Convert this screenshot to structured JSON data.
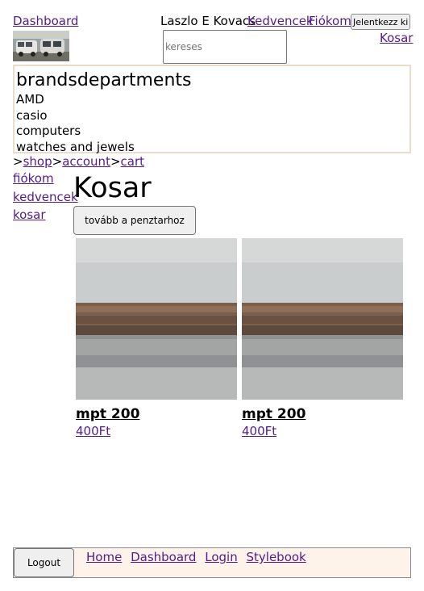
{
  "header": {
    "dashboard_link": "Dashboard",
    "user_name": "Laszlo E Kovacs",
    "favorites_link": "Kedvencek",
    "account_link": "Fiókom",
    "logout_label": "Jelentkezz ki",
    "cart_link": "Kosar",
    "search_placeholder": "kereses",
    "search_value": ""
  },
  "categories": {
    "title": "brandsdepartments",
    "items": [
      "AMD",
      "casio",
      "computers",
      "watches and jewels"
    ]
  },
  "breadcrumb": {
    "separator": ">",
    "items": [
      "shop",
      "account",
      "cart"
    ]
  },
  "sidebar": {
    "items": [
      "fiókom",
      "kedvencek",
      "kosar"
    ]
  },
  "main": {
    "title": "Kosar",
    "checkout_label": "tovább a penztarhoz",
    "products": [
      {
        "name": "mpt 200",
        "price": "400Ft"
      },
      {
        "name": "mpt 200",
        "price": "400Ft"
      }
    ]
  },
  "footer": {
    "logout_label": "Logout",
    "links": [
      "Home",
      "Dashboard",
      "Login",
      "Stylebook"
    ]
  }
}
